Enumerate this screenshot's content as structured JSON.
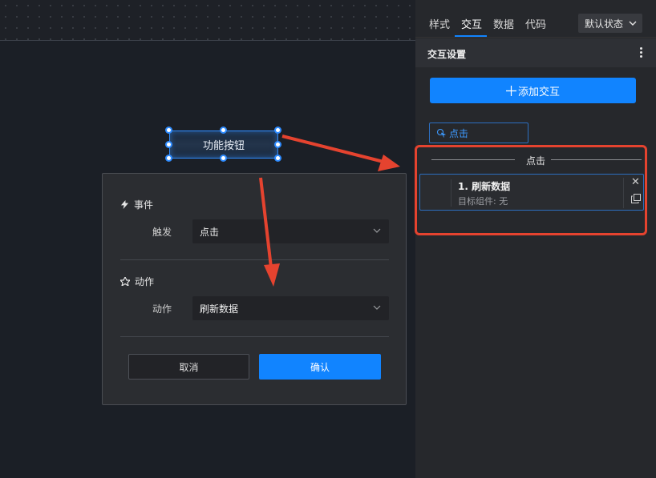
{
  "canvas": {
    "function_button_label": "功能按钮"
  },
  "dialog": {
    "event_section_title": "事件",
    "trigger_label": "触发",
    "trigger_value": "点击",
    "action_section_title": "动作",
    "action_label": "动作",
    "action_value": "刷新数据",
    "cancel_label": "取消",
    "confirm_label": "确认"
  },
  "panel": {
    "tabs": [
      {
        "label": "样式"
      },
      {
        "label": "交互"
      },
      {
        "label": "数据"
      },
      {
        "label": "代码"
      }
    ],
    "active_tab": "交互",
    "state_select_value": "默认状态",
    "section_title": "交互设置",
    "add_button_label": "添加交互",
    "event_chip_label": "点击",
    "group_label": "点击",
    "action_card": {
      "title": "1. 刷新数据",
      "subtitle": "目标组件: 无"
    }
  },
  "colors": {
    "accent": "#1184ff",
    "annotation_red": "#e5432f",
    "panel_bg": "#26282c",
    "canvas_bg": "#1b1f26"
  },
  "icons": [
    "lightning-icon",
    "action-icon",
    "chevron-down-icon",
    "plus-icon",
    "pointer-click-icon",
    "close-icon",
    "copy-icon",
    "more-vertical-icon"
  ]
}
